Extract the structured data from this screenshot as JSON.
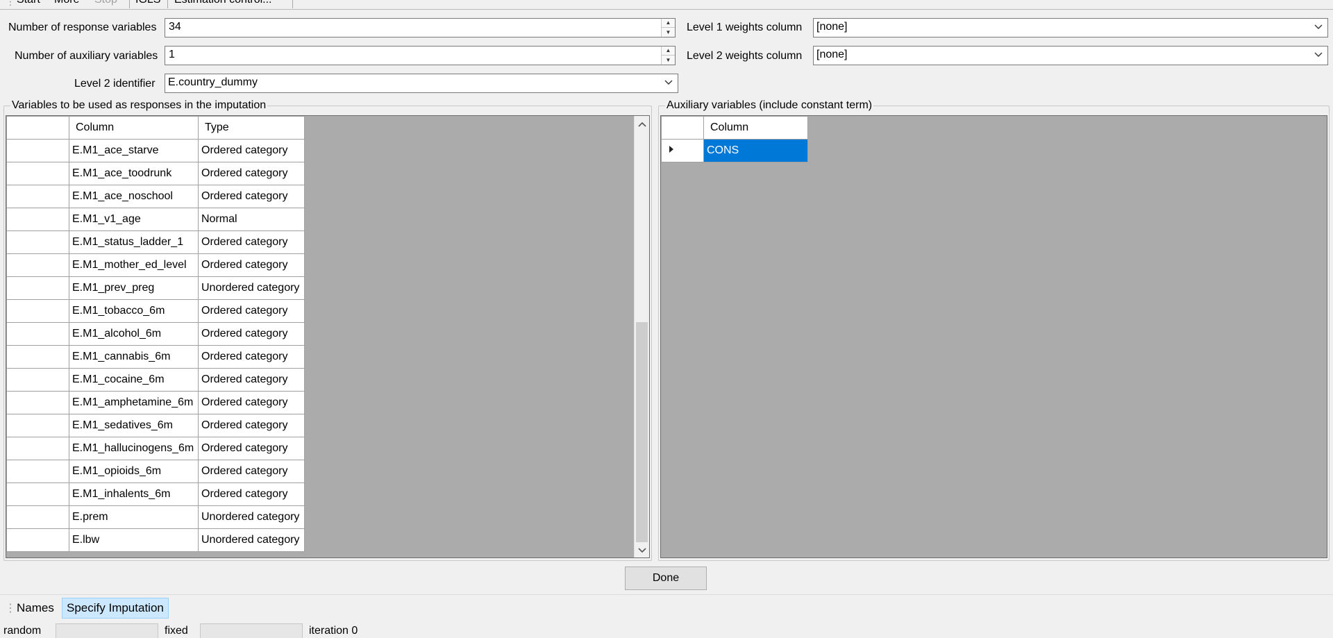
{
  "toolbar": {
    "items": [
      "Start",
      "More",
      "Stop",
      "IGLS",
      "Estimation control..."
    ]
  },
  "form": {
    "num_response_label": "Number of response variables",
    "num_response_value": "34",
    "num_aux_label": "Number of auxiliary variables",
    "num_aux_value": "1",
    "level2_id_label": "Level 2 identifier",
    "level2_id_value": "E.country_dummy",
    "level1_weights_label": "Level 1 weights column",
    "level1_weights_value": "[none]",
    "level2_weights_label": "Level 2 weights column",
    "level2_weights_value": "[none]"
  },
  "responses": {
    "title": "Variables to be used as responses in the imputation",
    "headers": {
      "column": "Column",
      "type": "Type"
    },
    "rows": [
      {
        "column": "E.M1_ace_starve",
        "type": "Ordered category"
      },
      {
        "column": "E.M1_ace_toodrunk",
        "type": "Ordered category"
      },
      {
        "column": "E.M1_ace_noschool",
        "type": "Ordered category"
      },
      {
        "column": "E.M1_v1_age",
        "type": "Normal"
      },
      {
        "column": "E.M1_status_ladder_1",
        "type": "Ordered category"
      },
      {
        "column": "E.M1_mother_ed_level",
        "type": "Ordered category"
      },
      {
        "column": "E.M1_prev_preg",
        "type": "Unordered category"
      },
      {
        "column": "E.M1_tobacco_6m",
        "type": "Ordered category"
      },
      {
        "column": "E.M1_alcohol_6m",
        "type": "Ordered category"
      },
      {
        "column": "E.M1_cannabis_6m",
        "type": "Ordered category"
      },
      {
        "column": "E.M1_cocaine_6m",
        "type": "Ordered category"
      },
      {
        "column": "E.M1_amphetamine_6m",
        "type": "Ordered category"
      },
      {
        "column": "E.M1_sedatives_6m",
        "type": "Ordered category"
      },
      {
        "column": "E.M1_hallucinogens_6m",
        "type": "Ordered category"
      },
      {
        "column": "E.M1_opioids_6m",
        "type": "Ordered category"
      },
      {
        "column": "E.M1_inhalents_6m",
        "type": "Ordered category"
      },
      {
        "column": "E.prem",
        "type": "Unordered category"
      },
      {
        "column": "E.lbw",
        "type": "Unordered category"
      }
    ]
  },
  "auxiliary": {
    "title": "Auxiliary variables (include constant term)",
    "headers": {
      "column": "Column"
    },
    "rows": [
      {
        "column": "CONS"
      }
    ]
  },
  "done_button": "Done",
  "tabs": [
    "Names",
    "Specify Imputation"
  ],
  "status": {
    "random_label": "random",
    "fixed_label": "fixed",
    "iteration_text": "iteration 0"
  }
}
